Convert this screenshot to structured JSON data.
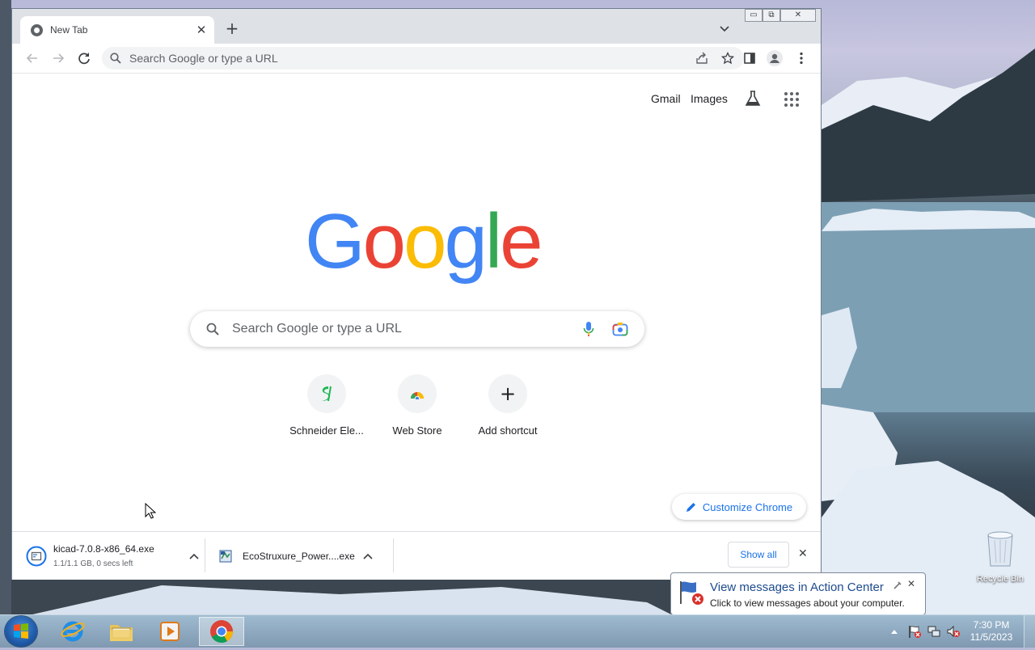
{
  "browser": {
    "tab": {
      "title": "New Tab",
      "close": "✕"
    },
    "new_tab": "+",
    "window_controls": {
      "minimize": "▭",
      "restore": "⧉",
      "close": "✕"
    },
    "omnibox": {
      "placeholder": "Search Google or type a URL"
    }
  },
  "ntp": {
    "top_links": {
      "gmail": "Gmail",
      "images": "Images"
    },
    "logo": {
      "letters": [
        "G",
        "o",
        "o",
        "g",
        "l",
        "e"
      ],
      "colors": [
        "#4285f4",
        "#ea4335",
        "#fbbc05",
        "#4285f4",
        "#34a853",
        "#ea4335"
      ]
    },
    "search": {
      "placeholder": "Search Google or type a URL"
    },
    "shortcuts": [
      {
        "label": "Schneider Ele...",
        "icon": "schneider-logo-icon"
      },
      {
        "label": "Web Store",
        "icon": "webstore-icon"
      },
      {
        "label": "Add shortcut",
        "icon": "plus-icon",
        "symbol": "+"
      }
    ],
    "customize_label": "Customize Chrome"
  },
  "downloads": {
    "items": [
      {
        "name": "kicad-7.0.8-x86_64.exe",
        "status": "1.1/1.1 GB, 0 secs left"
      },
      {
        "name": "EcoStruxure_Power....exe",
        "status": ""
      }
    ],
    "show_all": "Show all",
    "close": "✕"
  },
  "desktop": {
    "recycle_bin": "Recycle Bin"
  },
  "notification": {
    "title": "View messages in Action Center",
    "text": "Click to view messages about your computer.",
    "close": "✕"
  },
  "taskbar": {
    "time": "7:30 PM",
    "date": "11/5/2023",
    "apps": [
      "internet-explorer",
      "file-explorer",
      "media-player",
      "chrome"
    ]
  },
  "colors": {
    "accent": "#1a73e8",
    "tab_strip": "#dee1e6"
  }
}
